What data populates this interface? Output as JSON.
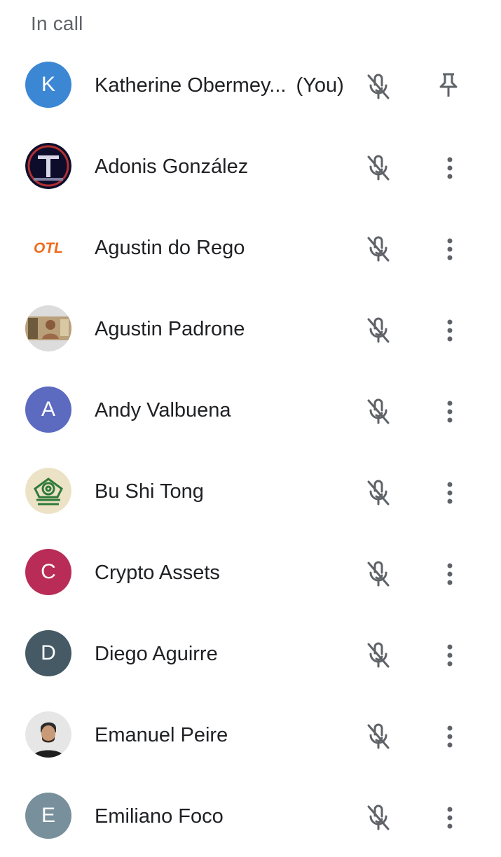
{
  "section": {
    "title": "In call"
  },
  "participants": [
    {
      "name": "Katherine Obermey...",
      "suffix": "(You)",
      "avatar": {
        "type": "letter",
        "letter": "K",
        "color": "#3b87d4"
      },
      "action": "pin-icon"
    },
    {
      "name": "Adonis González",
      "avatar": {
        "type": "image",
        "icon": "t-logo-avatar"
      },
      "action": "more-vert-icon"
    },
    {
      "name": "Agustin do Rego",
      "avatar": {
        "type": "image",
        "icon": "otl-logo-avatar",
        "text": "OTL"
      },
      "action": "more-vert-icon"
    },
    {
      "name": "Agustin Padrone",
      "avatar": {
        "type": "image",
        "icon": "photo-avatar"
      },
      "action": "more-vert-icon"
    },
    {
      "name": "Andy Valbuena",
      "avatar": {
        "type": "letter",
        "letter": "A",
        "color": "#5c6bc0"
      },
      "action": "more-vert-icon"
    },
    {
      "name": "Bu Shi Tong",
      "avatar": {
        "type": "image",
        "icon": "earth-kingdom-emblem-avatar"
      },
      "action": "more-vert-icon"
    },
    {
      "name": "Crypto Assets",
      "avatar": {
        "type": "letter",
        "letter": "C",
        "color": "#b92c58"
      },
      "action": "more-vert-icon"
    },
    {
      "name": "Diego Aguirre",
      "avatar": {
        "type": "letter",
        "letter": "D",
        "color": "#455a64"
      },
      "action": "more-vert-icon"
    },
    {
      "name": "Emanuel Peire",
      "avatar": {
        "type": "image",
        "icon": "photo-avatar"
      },
      "action": "more-vert-icon"
    },
    {
      "name": "Emiliano Foco",
      "avatar": {
        "type": "letter",
        "letter": "E",
        "color": "#78909c"
      },
      "action": "more-vert-icon"
    }
  ],
  "colors": {
    "icon": "#5f6368",
    "text": "#202124",
    "subtle": "#5f6368"
  }
}
